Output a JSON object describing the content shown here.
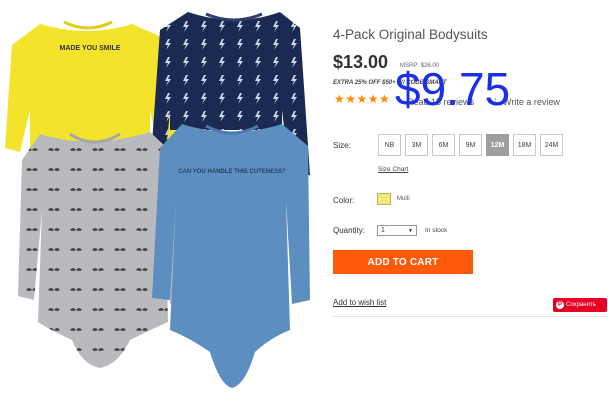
{
  "product": {
    "title": "4-Pack Original Bodysuits",
    "price": "$13.00",
    "msrp": "MSRP: $26.00",
    "promo": "EXTRA 25% OFF $50+ W/ CODE SMART",
    "stars": "★★★★★",
    "reviews_text": "Read 15 reviews",
    "write_review": "Write a review",
    "separator": "|",
    "overlay_price": "$9.75"
  },
  "options": {
    "size_label": "Size:",
    "sizes": [
      "NB",
      "3M",
      "6M",
      "9M",
      "12M",
      "18M",
      "24M"
    ],
    "selected_size": "12M",
    "size_chart": "Size Chart",
    "color_label": "Color:",
    "color_name": "Multi",
    "swatch_color": "#f1e87a",
    "quantity_label": "Quantity:",
    "quantity_value": "1",
    "stock_status": "In stock"
  },
  "actions": {
    "add_to_cart": "ADD TO CART",
    "wish_list": "Add to wish list",
    "save_label": "Сохранить"
  },
  "colors": {
    "accent": "#ff5a0a",
    "pinterest": "#e60023",
    "overlay": "#1a2fe6",
    "stars": "#ff8a00"
  },
  "image": {
    "top_left_print": "MADE YOU SMILE",
    "right_front_print": "CAN YOU HANDLE THIS CUTENESS?"
  }
}
